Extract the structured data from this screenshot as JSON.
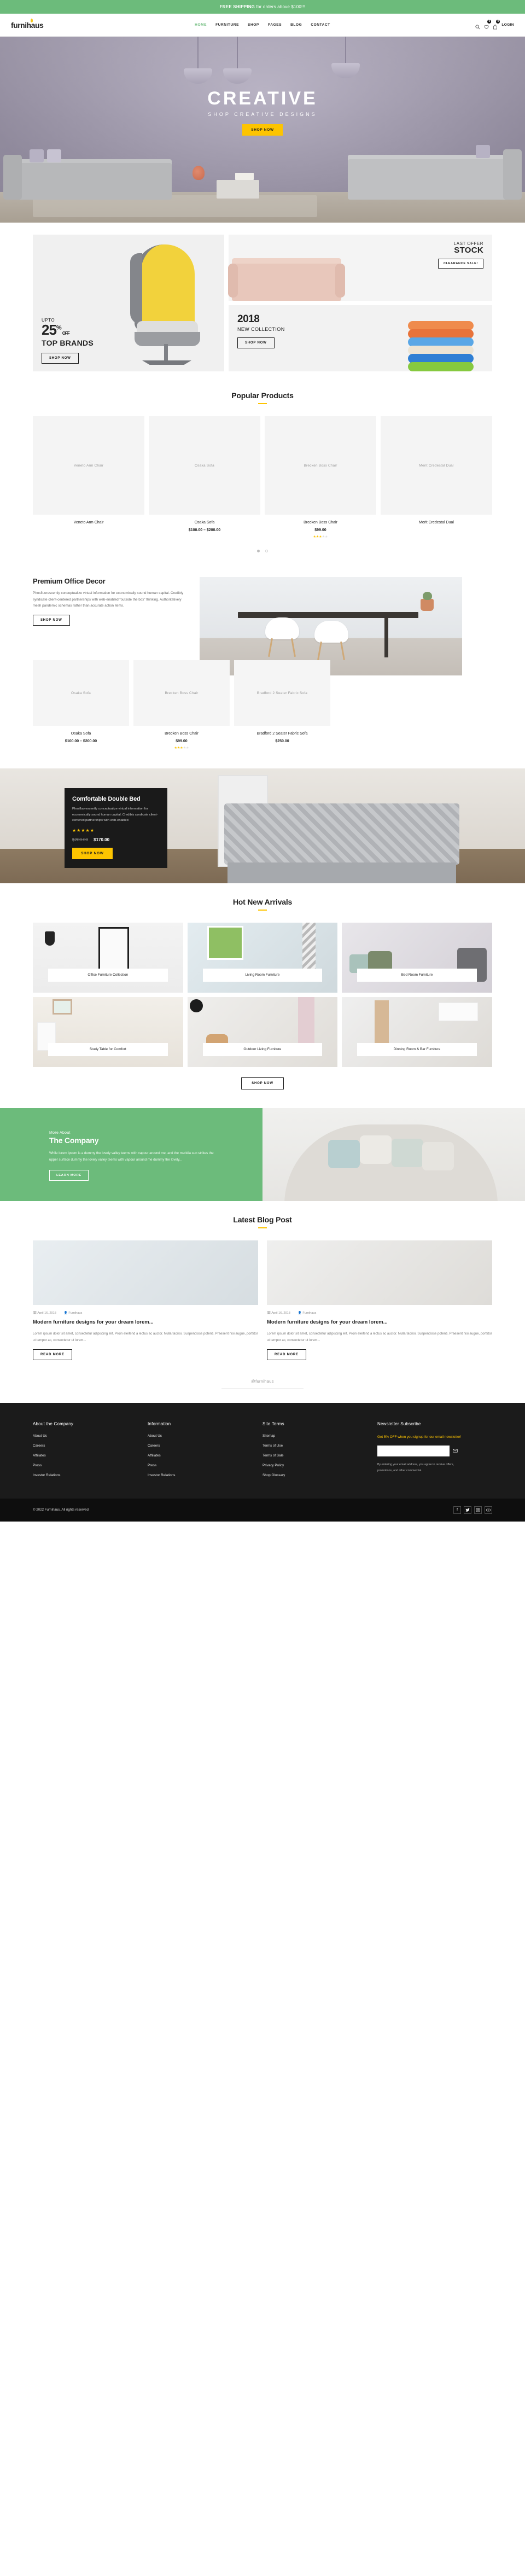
{
  "topbar": {
    "bold": "FREE SHIPPING",
    "rest": " for orders above $100!!!"
  },
  "header": {
    "logo": "furnihaus",
    "nav": [
      {
        "label": "HOME",
        "active": true
      },
      {
        "label": "FURNITURE",
        "active": false
      },
      {
        "label": "SHOP",
        "active": false
      },
      {
        "label": "PAGES",
        "active": false
      },
      {
        "label": "BLOG",
        "active": false
      },
      {
        "label": "CONTACT",
        "active": false
      }
    ],
    "wishlist_count": "0",
    "cart_count": "0",
    "login_label": "LOGIN"
  },
  "hero": {
    "title": "CREATIVE",
    "subtitle": "SHOP CREATIVE DESIGNS",
    "cta": "SHOP NOW"
  },
  "promo": {
    "left": {
      "upto": "UPTO",
      "number": "25",
      "percent": "%",
      "off": "OFF",
      "brands": "TOP BRANDS",
      "cta": "SHOP NOW"
    },
    "top": {
      "kicker": "LAST OFFER",
      "title": "STOCK",
      "chip": "CLEARANCE SALE!"
    },
    "bottom": {
      "year": "2018",
      "title": "NEW COLLECTION",
      "cta": "SHOP NOW"
    }
  },
  "popular": {
    "heading": "Popular Products",
    "products": [
      {
        "name": "Veneto Arm Chair",
        "price": "",
        "rating": 0
      },
      {
        "name": "Osaka Sofa",
        "price": "$100.00 – $200.00",
        "rating": 0
      },
      {
        "name": "Brecken Boss Chair",
        "price": "$99.00",
        "rating": 3
      },
      {
        "name": "Merit Credestal Dual",
        "price": "",
        "rating": 0
      }
    ]
  },
  "office": {
    "title": "Premium Office Decor",
    "body": "Phosfluorescently conceptualize virtual information for economically sound human capital. Credibly syndicate client-centered partnerships with web-enabled “outside the box” thinking. Authoritatively mesh pandemic schemas rather than accurate action items.",
    "cta": "SHOP NOW",
    "products": [
      {
        "name": "Osaka Sofa",
        "price": "$100.00 – $200.00",
        "rating": 0
      },
      {
        "name": "Brecken Boss Chair",
        "price": "$99.00",
        "rating": 3
      },
      {
        "name": "Bradford 2 Seater Fabric Sofa",
        "price": "$250.00",
        "rating": 0
      }
    ]
  },
  "bed": {
    "title": "Comfortable Double Bed",
    "body": "Phosfluorescently conceptualize virtual information for economically sound human capital. Credibly syndicate client-centered partnerships with web-enabled",
    "rating": 5,
    "old_price": "$200.00",
    "new_price": "$170.00",
    "cta": "SHOP NOW"
  },
  "arrivals": {
    "heading": "Hot New Arrivals",
    "items": [
      {
        "label": "Office Furniture Collection"
      },
      {
        "label": "Living Room Furniture"
      },
      {
        "label": "Bed Room Furniture"
      },
      {
        "label": "Study Table for Comfort"
      },
      {
        "label": "Outdoor Living Furniture"
      },
      {
        "label": "Dinning Room & Bar Furniture"
      }
    ],
    "cta": "SHOP NOW"
  },
  "company": {
    "kicker": "More About",
    "title": "The Company",
    "body": "While lorem ipsum is a dummy the lovely valley teems with vapour around me, and the meridia sun strikes the upper surface dummy the lovely valley teems with vapour around me dummy the lovely...",
    "cta": "LEARN MORE"
  },
  "blog": {
    "heading": "Latest Blog Post",
    "posts": [
      {
        "date": "April 16, 2018",
        "author": "Furnihaus",
        "title": "Modern furniture designs for your dream lorem...",
        "excerpt": "Lorem ipsum dolor sit amet, consectetur adipiscing elit. Proin eleifend a lectus ac auctor. Nulla facilisi. Suspendisse potenti. Praesent nisi augue, porttitor ut tempor ac, consectetur ut lorem...",
        "cta": "READ MORE"
      },
      {
        "date": "April 16, 2018",
        "author": "Furnihaus",
        "title": "Modern furniture designs for your dream lorem...",
        "excerpt": "Lorem ipsum dolor sit amet, consectetur adipiscing elit. Proin eleifend a lectus ac auctor. Nulla facilisi. Suspendisse potenti. Praesent nisi augue, porttitor ut tempor ac, consectetur ut lorem...",
        "cta": "READ MORE"
      }
    ]
  },
  "instagram": {
    "handle": "@furnihaus"
  },
  "footer": {
    "columns": [
      {
        "title": "About the Company",
        "links": [
          "About Us",
          "Careers",
          "Affiliates",
          "Press",
          "Investor Relations"
        ]
      },
      {
        "title": "Information",
        "links": [
          "About Us",
          "Careers",
          "Affiliates",
          "Press",
          "Investor Relations"
        ]
      },
      {
        "title": "Site Terms",
        "links": [
          "Sitemap",
          "Terms of Use",
          "Terms of Sale",
          "Privacy Policy",
          "Shop Glossary"
        ]
      }
    ],
    "newsletter": {
      "title": "Newsletter Subscribe",
      "lead": "Get 5% OFF when you signup for our email newsletter!",
      "input_value": "",
      "input_placeholder": "",
      "note": "By entering your email address, you agree to receive offers, promotions, and other commercial."
    },
    "copyright": "© 2022 Furnihaus. All rights reserved",
    "socials": [
      "facebook-icon",
      "twitter-icon",
      "instagram-icon",
      "youtube-icon"
    ]
  },
  "colors": {
    "green": "#6cbb7b",
    "yellow": "#fdc400",
    "dark": "#1b1b1b"
  }
}
